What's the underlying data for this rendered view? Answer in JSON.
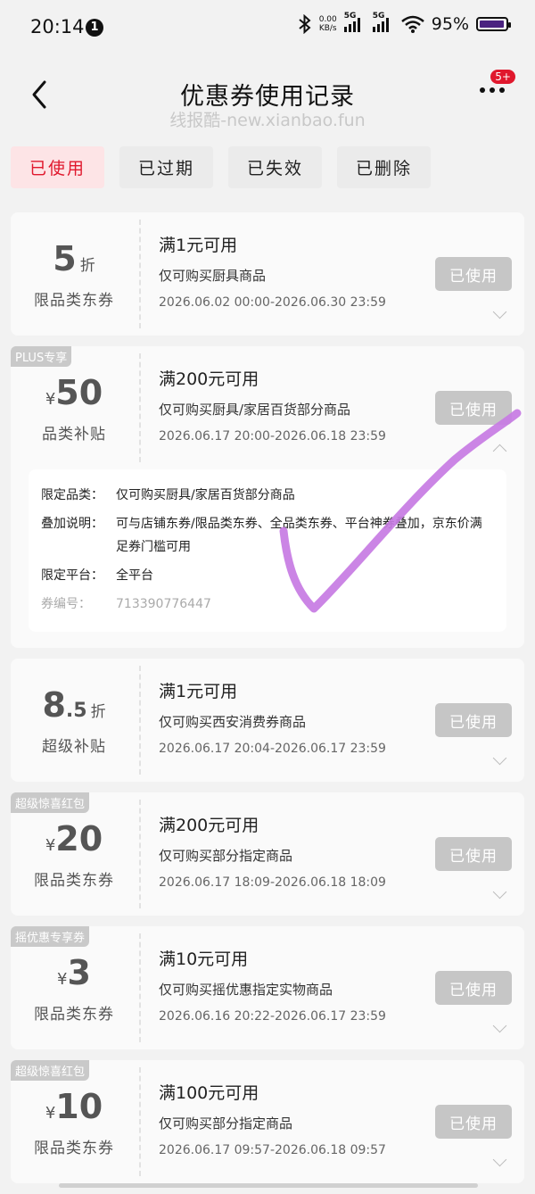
{
  "status_bar": {
    "time": "20:14",
    "notification_count": "1",
    "net_speed_value": "0.00",
    "net_speed_unit": "KB/s",
    "signal1_label": "5G",
    "signal2_label": "5G",
    "battery": "95%",
    "battery_level": 0.95
  },
  "header": {
    "title": "优惠券使用记录",
    "watermark": "线报酷-new.xianbao.fun",
    "more_badge": "5+"
  },
  "tabs": [
    "已使用",
    "已过期",
    "已失效",
    "已删除"
  ],
  "coupons": [
    {
      "tag": "",
      "currency": "",
      "amount": "5",
      "amount_decimal": "",
      "unit": "折",
      "type": "限品类东券",
      "threshold": "满1元可用",
      "scope": "仅可购买厨具商品",
      "validity": "2026.06.02 00:00-2026.06.30 23:59",
      "status": "已使用"
    },
    {
      "tag": "PLUS专享",
      "currency": "¥",
      "amount": "50",
      "amount_decimal": "",
      "unit": "",
      "type": "品类补贴",
      "threshold": "满200元可用",
      "scope": "仅可购买厨具/家居百货部分商品",
      "validity": "2026.06.17 20:00-2026.06.18 23:59",
      "status": "已使用",
      "details": {
        "category_label": "限定品类：",
        "category_value": "仅可购买厨具/家居百货部分商品",
        "stacking_label": "叠加说明：",
        "stacking_value": "可与店铺东券/限品类东券、全品类东券、平台神券叠加，京东价满足券门槛可用",
        "platform_label": "限定平台：",
        "platform_value": "全平台",
        "coupon_no_label": "券编号：",
        "coupon_no_value": "713390776447"
      }
    },
    {
      "tag": "",
      "currency": "",
      "amount": "8",
      "amount_decimal": ".5",
      "unit": "折",
      "type": "超级补贴",
      "threshold": "满1元可用",
      "scope": "仅可购买西安消费券商品",
      "validity": "2026.06.17 20:04-2026.06.17 23:59",
      "status": "已使用"
    },
    {
      "tag": "超级惊喜红包",
      "currency": "¥",
      "amount": "20",
      "amount_decimal": "",
      "unit": "",
      "type": "限品类东券",
      "threshold": "满200元可用",
      "scope": "仅可购买部分指定商品",
      "validity": "2026.06.17 18:09-2026.06.18 18:09",
      "status": "已使用"
    },
    {
      "tag": "摇优惠专享券",
      "currency": "¥",
      "amount": "3",
      "amount_decimal": "",
      "unit": "",
      "type": "限品类东券",
      "threshold": "满10元可用",
      "scope": "仅可购买摇优惠指定实物商品",
      "validity": "2026.06.16 20:22-2026.06.17 23:59",
      "status": "已使用"
    },
    {
      "tag": "超级惊喜红包",
      "currency": "¥",
      "amount": "10",
      "amount_decimal": "",
      "unit": "",
      "type": "限品类东券",
      "threshold": "满100元可用",
      "scope": "仅可购买部分指定商品",
      "validity": "2026.06.17 09:57-2026.06.18 09:57",
      "status": "已使用"
    }
  ],
  "colors": {
    "accent": "#e0182d",
    "active_tab_bg": "#fde4e6",
    "used_button": "#c6c6c6",
    "checkmark": "#c77be3"
  },
  "icons": [
    "back-arrow-icon",
    "more-dots-icon",
    "bluetooth-icon",
    "wifi-icon",
    "battery-icon",
    "chevron-down-icon",
    "chevron-up-icon"
  ]
}
